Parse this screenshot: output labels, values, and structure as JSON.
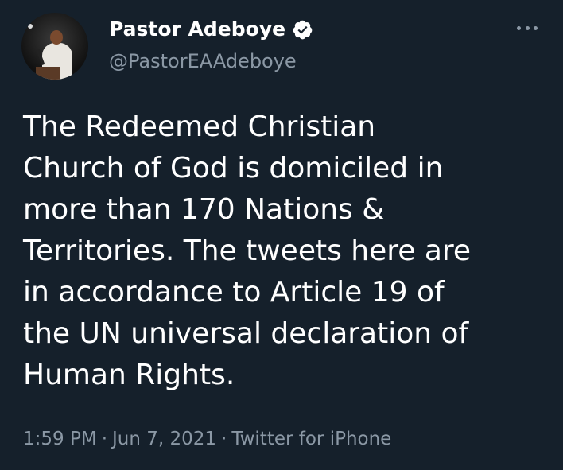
{
  "author": {
    "display_name": "Pastor Adeboye",
    "handle": "@PastorEAAdeboye",
    "verified_icon": "verified-badge-icon"
  },
  "tweet": {
    "text": "The Redeemed Christian\nChurch of God is domiciled in\nmore than 170 Nations &\nTerritories. The tweets here are\nin accordance to Article 19 of\nthe UN universal declaration of\nHuman Rights.",
    "time": "1:59 PM",
    "date": "Jun 7, 2021",
    "source": "Twitter for iPhone",
    "separator": "·"
  },
  "menu": {
    "icon": "more-options-icon"
  },
  "colors": {
    "background": "#15202b",
    "primary_text": "#ffffff",
    "secondary_text": "#8b98a5"
  }
}
